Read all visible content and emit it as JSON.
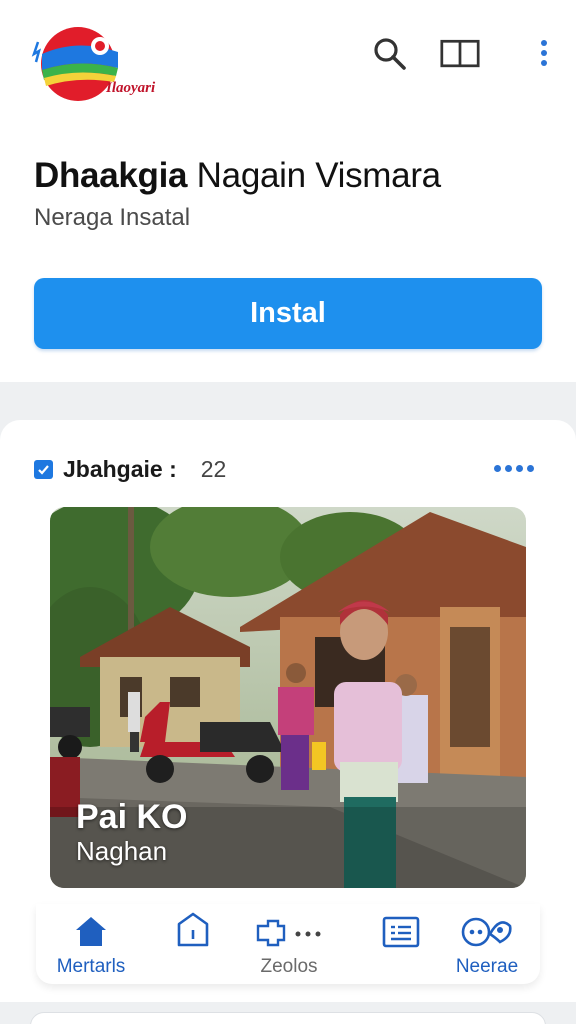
{
  "app": {
    "logo_text": "Ilaoyari",
    "title_bold": "Dhaakgia",
    "title_rest": "Nagain Vismara",
    "subtitle": "Neraga Insatal",
    "install_label": "Instal"
  },
  "post": {
    "author": "Jbahgaie :",
    "count": "22",
    "caption_line1": "Pai KO",
    "caption_line2": "Naghan"
  },
  "bottom_nav": {
    "items": [
      {
        "label": "Mertarls",
        "icon": "home-icon",
        "active": true
      },
      {
        "label": "",
        "icon": "tag-icon",
        "active": false
      },
      {
        "label": "Zeolos",
        "icon": "puzzle-more-icon",
        "active": false
      },
      {
        "label": "",
        "icon": "list-card-icon",
        "active": false
      },
      {
        "label": "Neerae",
        "icon": "chat-people-icon",
        "active": true
      }
    ]
  },
  "colors": {
    "accent": "#1e90ee",
    "nav_active": "#1f5fbf",
    "background": "#eef0f2"
  }
}
